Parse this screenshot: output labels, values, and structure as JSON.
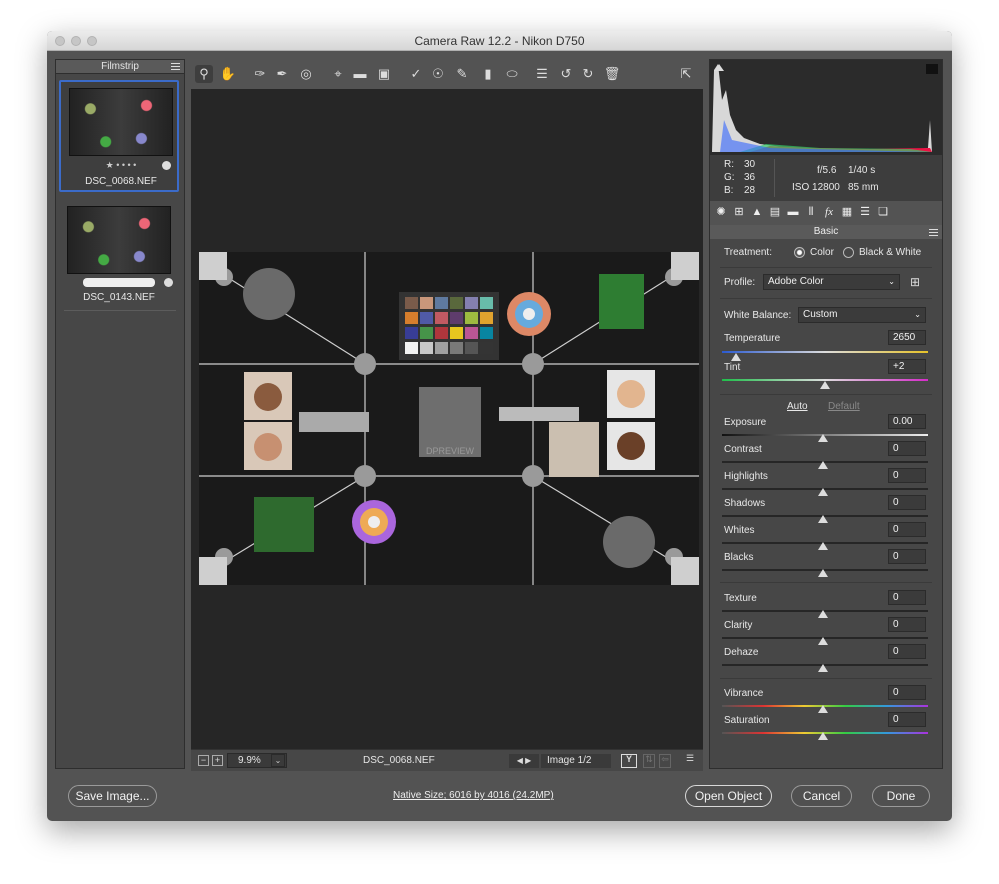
{
  "window": {
    "title": "Camera Raw 12.2  -  Nikon D750"
  },
  "filmstrip": {
    "title": "Filmstrip",
    "items": [
      {
        "name": "DSC_0068.NEF",
        "rating": "★ • • • •"
      },
      {
        "name": "DSC_0143.NEF",
        "rating": ""
      }
    ]
  },
  "preview": {
    "zoom": "9.9%",
    "filename": "DSC_0068.NEF",
    "image_counter": "Image 1/2",
    "watermark": "DPREVIEW"
  },
  "info": {
    "r_label": "R:",
    "r": "30",
    "g_label": "G:",
    "g": "36",
    "b_label": "B:",
    "b": "28",
    "aperture": "f/5.6",
    "shutter": "1/40 s",
    "iso": "ISO 12800",
    "focal": "85 mm"
  },
  "basic": {
    "title": "Basic",
    "treatment_label": "Treatment:",
    "treatment_color": "Color",
    "treatment_bw": "Black & White",
    "profile_label": "Profile:",
    "profile_value": "Adobe Color",
    "wb_label": "White Balance:",
    "wb_value": "Custom",
    "temperature_label": "Temperature",
    "temperature": "2650",
    "tint_label": "Tint",
    "tint": "+2",
    "auto": "Auto",
    "default": "Default",
    "exposure_label": "Exposure",
    "exposure": "0.00",
    "contrast_label": "Contrast",
    "contrast": "0",
    "highlights_label": "Highlights",
    "highlights": "0",
    "shadows_label": "Shadows",
    "shadows": "0",
    "whites_label": "Whites",
    "whites": "0",
    "blacks_label": "Blacks",
    "blacks": "0",
    "texture_label": "Texture",
    "texture": "0",
    "clarity_label": "Clarity",
    "clarity": "0",
    "dehaze_label": "Dehaze",
    "dehaze": "0",
    "vibrance_label": "Vibrance",
    "vibrance": "0",
    "saturation_label": "Saturation",
    "saturation": "0"
  },
  "footer": {
    "save": "Save Image...",
    "native": "Native Size; 6016 by 4016 (24.2MP)",
    "open": "Open Object",
    "cancel": "Cancel",
    "done": "Done"
  },
  "colors": {
    "panel": "#474747",
    "canvas": "#262626",
    "selection": "#3b6bc9"
  }
}
